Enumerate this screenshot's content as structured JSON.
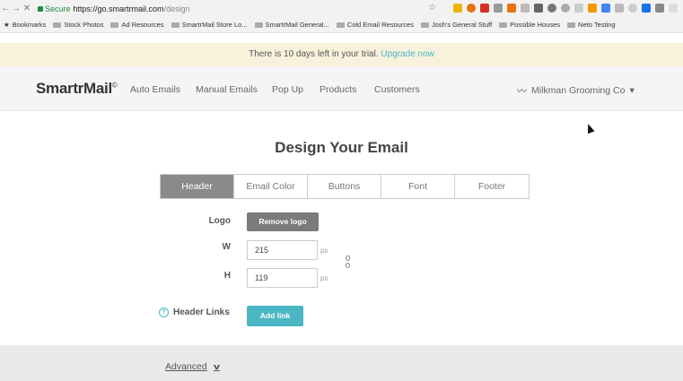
{
  "browser": {
    "secure_label": "Secure",
    "url_host": "https://go.smartrmail.com",
    "url_path": "/design",
    "bookmarks": [
      {
        "label": "Bookmarks"
      },
      {
        "label": "Stock Photos"
      },
      {
        "label": "Ad Resources"
      },
      {
        "label": "SmartrMail Store Lo..."
      },
      {
        "label": "SmartrMail General..."
      },
      {
        "label": "Cold Email Resources"
      },
      {
        "label": "Josh's General Stuff"
      },
      {
        "label": "Possible Houses"
      },
      {
        "label": "Neto Testing"
      }
    ]
  },
  "trial": {
    "message": "There is 10 days left in your trial.",
    "link": "Upgrade now"
  },
  "nav": {
    "logo": "SmartrMail",
    "logo_mark": "©",
    "items": [
      "Auto Emails",
      "Manual Emails",
      "Pop Up",
      "Products",
      "Customers"
    ],
    "account": "Milkman Grooming Co",
    "account_caret": "▾"
  },
  "page": {
    "title": "Design Your Email",
    "tabs": [
      "Header",
      "Email Color",
      "Buttons",
      "Font",
      "Footer"
    ],
    "active_tab": "Header"
  },
  "form": {
    "logo_label": "Logo",
    "remove_logo": "Remove logo",
    "w_label": "W",
    "w_value": "215",
    "h_label": "H",
    "h_value": "119",
    "unit": "px",
    "header_links_label": "Header Links",
    "help_glyph": "?",
    "add_link": "Add link",
    "advanced": "Advanced",
    "advanced_chevron": "v"
  },
  "colors": {
    "accent": "#4ab6c4",
    "active_tab": "#8a8a8a",
    "banner": "#f8f2dc"
  }
}
